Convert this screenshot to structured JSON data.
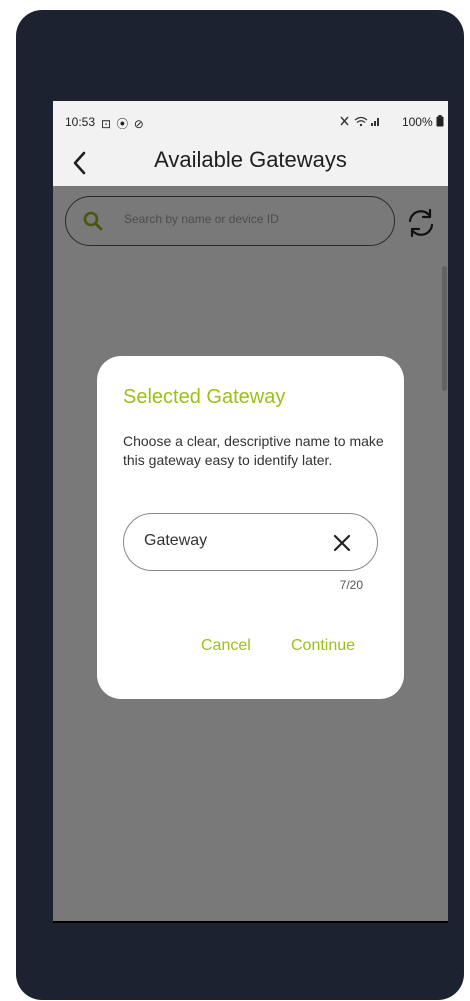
{
  "status_bar": {
    "time": "10:53",
    "left_icons": "⊡ ⦿ ⊘",
    "right_text": "100%"
  },
  "app_bar": {
    "title": "Available Gateways",
    "back_icon": "chevron-left-icon"
  },
  "search": {
    "placeholder": "Search by name or device ID",
    "icon": "search-icon",
    "refresh_icon": "refresh-icon"
  },
  "dialog": {
    "title": "Selected Gateway",
    "body": "Choose a clear, descriptive name to make this gateway easy to identify later.",
    "name_value": "Gateway",
    "counter": "7/20",
    "cancel_label": "Cancel",
    "continue_label": "Continue"
  },
  "colors": {
    "accent": "#9ac116",
    "frame": "#1d2230",
    "scrim": "rgba(0,0,0,0.5)"
  }
}
